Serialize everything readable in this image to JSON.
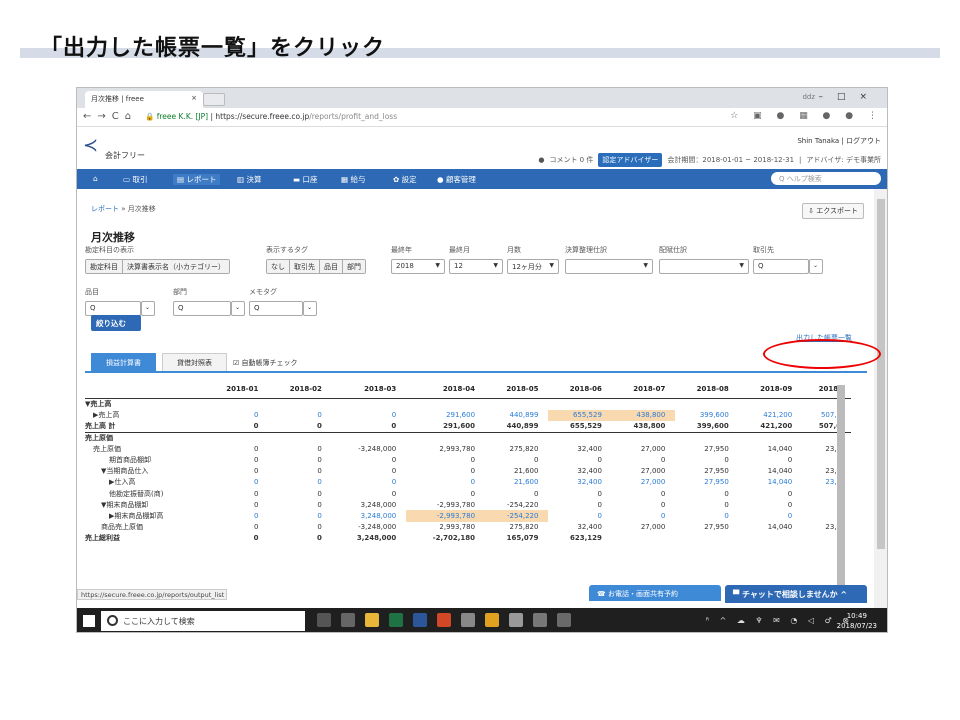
{
  "slide": {
    "title": "「出力した帳票一覧」をクリック"
  },
  "browser": {
    "tab_title": "月次推移 | freee",
    "url_secure": "freee K.K. [JP]",
    "url_host": "https://secure.freee.co.jp",
    "url_path": "/reports/profit_and_loss",
    "window_label": "ddz"
  },
  "header": {
    "logo_text": "会計フリー",
    "user": "Shin Tanaka",
    "logout": "ログアウト",
    "comments": "コメント 0 件",
    "advisor_badge": "認定アドバイザー",
    "period": "会計期間：2018-01-01 ~ 2018-12-31",
    "advisor": "アドバイザ: デモ事業所"
  },
  "nav": {
    "items": [
      "取引",
      "レポート",
      "決算",
      "口座",
      "給与",
      "設定",
      "顧客管理"
    ],
    "help_placeholder": "ヘルプ検索"
  },
  "page": {
    "breadcrumb_root": "レポート",
    "breadcrumb_current": "月次推移",
    "export_label": "エクスポート",
    "title": "月次推移"
  },
  "filters": {
    "account_display_label": "勘定科目の表示",
    "account_display_options": [
      "勘定科目",
      "決算書表示名（小カテゴリー）"
    ],
    "tag_label": "表示するタグ",
    "tag_options": [
      "なし",
      "取引先",
      "品目",
      "部門"
    ],
    "end_year_label": "最終年",
    "end_year": "2018",
    "end_month_label": "最終月",
    "end_month": "12",
    "months_label": "月数",
    "months": "12ヶ月分",
    "closing_label": "決算整理仕訳",
    "allocation_label": "配賦仕訳",
    "partner_label": "取引先",
    "item_label": "品目",
    "department_label": "部門",
    "memo_label": "メモタグ",
    "search_glyph": "Q",
    "submit_label": "絞り込む"
  },
  "output_list_link": "出力した帳票一覧",
  "report_tabs": {
    "pl": "損益計算書",
    "bs": "貸借対照表",
    "check": "自動帳簿チェック"
  },
  "table": {
    "columns": [
      "",
      "2018-01",
      "2018-02",
      "2018-03",
      "2018-04",
      "2018-05",
      "2018-06",
      "2018-07",
      "2018-08",
      "2018-09",
      "2018-"
    ],
    "rows": [
      {
        "label": "▼売上高",
        "indent": 0,
        "cells": [
          "",
          "",
          "",
          "",
          "",
          "",
          "",
          "",
          "",
          ""
        ],
        "bold": true
      },
      {
        "label": "▶売上高",
        "indent": 1,
        "cells": [
          "0",
          "0",
          "0",
          "291,600",
          "440,899",
          "655,529",
          "438,800",
          "399,600",
          "421,200",
          "507,6"
        ],
        "blue": true,
        "hl": [
          5,
          6
        ]
      },
      {
        "label": "売上高 計",
        "indent": 0,
        "cells": [
          "0",
          "0",
          "0",
          "291,600",
          "440,899",
          "655,529",
          "438,800",
          "399,600",
          "421,200",
          "507,6"
        ],
        "bold": true,
        "rule": true
      },
      {
        "label": "売上原価",
        "indent": 0,
        "cells": [
          "",
          "",
          "",
          "",
          "",
          "",
          "",
          "",
          "",
          ""
        ],
        "bold": true
      },
      {
        "label": "売上原価",
        "indent": 1,
        "cells": [
          "0",
          "0",
          "-3,248,000",
          "2,993,780",
          "275,820",
          "32,400",
          "27,000",
          "27,950",
          "14,040",
          "23,7"
        ]
      },
      {
        "label": "期首商品棚卸",
        "indent": 3,
        "cells": [
          "0",
          "0",
          "0",
          "0",
          "0",
          "0",
          "0",
          "0",
          "0",
          ""
        ]
      },
      {
        "label": "▼当期商品仕入",
        "indent": 2,
        "cells": [
          "0",
          "0",
          "0",
          "0",
          "21,600",
          "32,400",
          "27,000",
          "27,950",
          "14,040",
          "23,7"
        ]
      },
      {
        "label": "▶仕入高",
        "indent": 3,
        "cells": [
          "0",
          "0",
          "0",
          "0",
          "21,600",
          "32,400",
          "27,000",
          "27,950",
          "14,040",
          "23,7"
        ],
        "blue": true
      },
      {
        "label": "他勘定振替高(商)",
        "indent": 3,
        "cells": [
          "0",
          "0",
          "0",
          "0",
          "0",
          "0",
          "0",
          "0",
          "0",
          ""
        ]
      },
      {
        "label": "▼期末商品棚卸",
        "indent": 2,
        "cells": [
          "0",
          "0",
          "3,248,000",
          "-2,993,780",
          "-254,220",
          "0",
          "0",
          "0",
          "0",
          ""
        ]
      },
      {
        "label": "▶期末商品棚卸高",
        "indent": 3,
        "cells": [
          "0",
          "0",
          "3,248,000",
          "-2,993,780",
          "-254,220",
          "0",
          "0",
          "0",
          "0",
          ""
        ],
        "blue": true,
        "hl": [
          3,
          4
        ]
      },
      {
        "label": "商品売上原価",
        "indent": 2,
        "cells": [
          "0",
          "0",
          "-3,248,000",
          "2,993,780",
          "275,820",
          "32,400",
          "27,000",
          "27,950",
          "14,040",
          "23,7"
        ]
      },
      {
        "label": "売上総利益",
        "indent": 0,
        "cells": [
          "0",
          "0",
          "3,248,000",
          "-2,702,180",
          "165,079",
          "623,129",
          "",
          "",
          "",
          ""
        ],
        "bold": true
      }
    ]
  },
  "status_url": "https://secure.freee.co.jp/reports/output_list",
  "call_button": "お電話・画面共有予約",
  "chat_button": "チャットで相談しませんか",
  "taskbar": {
    "search": "ここに入力して検索",
    "time": "10:49",
    "date": "2018/07/23",
    "notif": "2"
  }
}
